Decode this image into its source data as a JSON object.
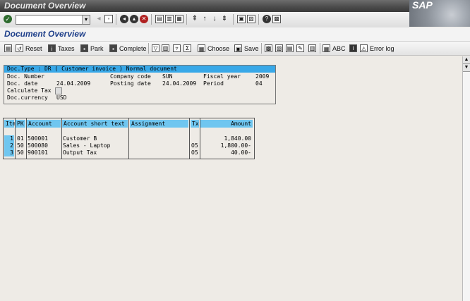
{
  "window": {
    "title": "Document Overview"
  },
  "brand": {
    "logo_text": "SAP"
  },
  "screen": {
    "title": "Document Overview"
  },
  "app_toolbar": {
    "reset": "Reset",
    "taxes": "Taxes",
    "park": "Park",
    "complete": "Complete",
    "choose": "Choose",
    "save": "Save",
    "abc": "ABC",
    "error_log": "Error log"
  },
  "header": {
    "strip": "Doc.Type  : DR ( Customer invoice ) Normal document",
    "doc_number_label": "Doc. Number",
    "company_code_label": "Company code",
    "company_code": "SUN",
    "fiscal_year_label": "Fiscal year",
    "fiscal_year": "2009",
    "doc_date_label": "Doc. date",
    "doc_date": "24.04.2009",
    "posting_date_label": "Posting date",
    "posting_date": "24.04.2009",
    "period_label": "Period",
    "period": "04",
    "calc_tax_label": "Calculate Tax",
    "currency_label": "Doc.currency",
    "currency": "USD"
  },
  "table": {
    "columns": [
      "Itm",
      "PK",
      "Account",
      "Account short text",
      "Assignment",
      "Tx",
      "Amount"
    ],
    "rows": [
      {
        "itm": "1",
        "pk": "01",
        "account": "500001",
        "short_text": "Customer B",
        "assignment": "",
        "tx": "",
        "amount": "1,840.00"
      },
      {
        "itm": "2",
        "pk": "50",
        "account": "500080",
        "short_text": "Sales - Laptop",
        "assignment": "",
        "tx": "O5",
        "amount": "1,800.00-"
      },
      {
        "itm": "3",
        "pk": "50",
        "account": "900101",
        "short_text": "Output Tax",
        "assignment": "",
        "tx": "O5",
        "amount": "40.00-"
      }
    ]
  },
  "colors": {
    "accent": "#38a8e8",
    "header_cell": "#6fc6f0",
    "title_text": "#1e3f8a"
  }
}
